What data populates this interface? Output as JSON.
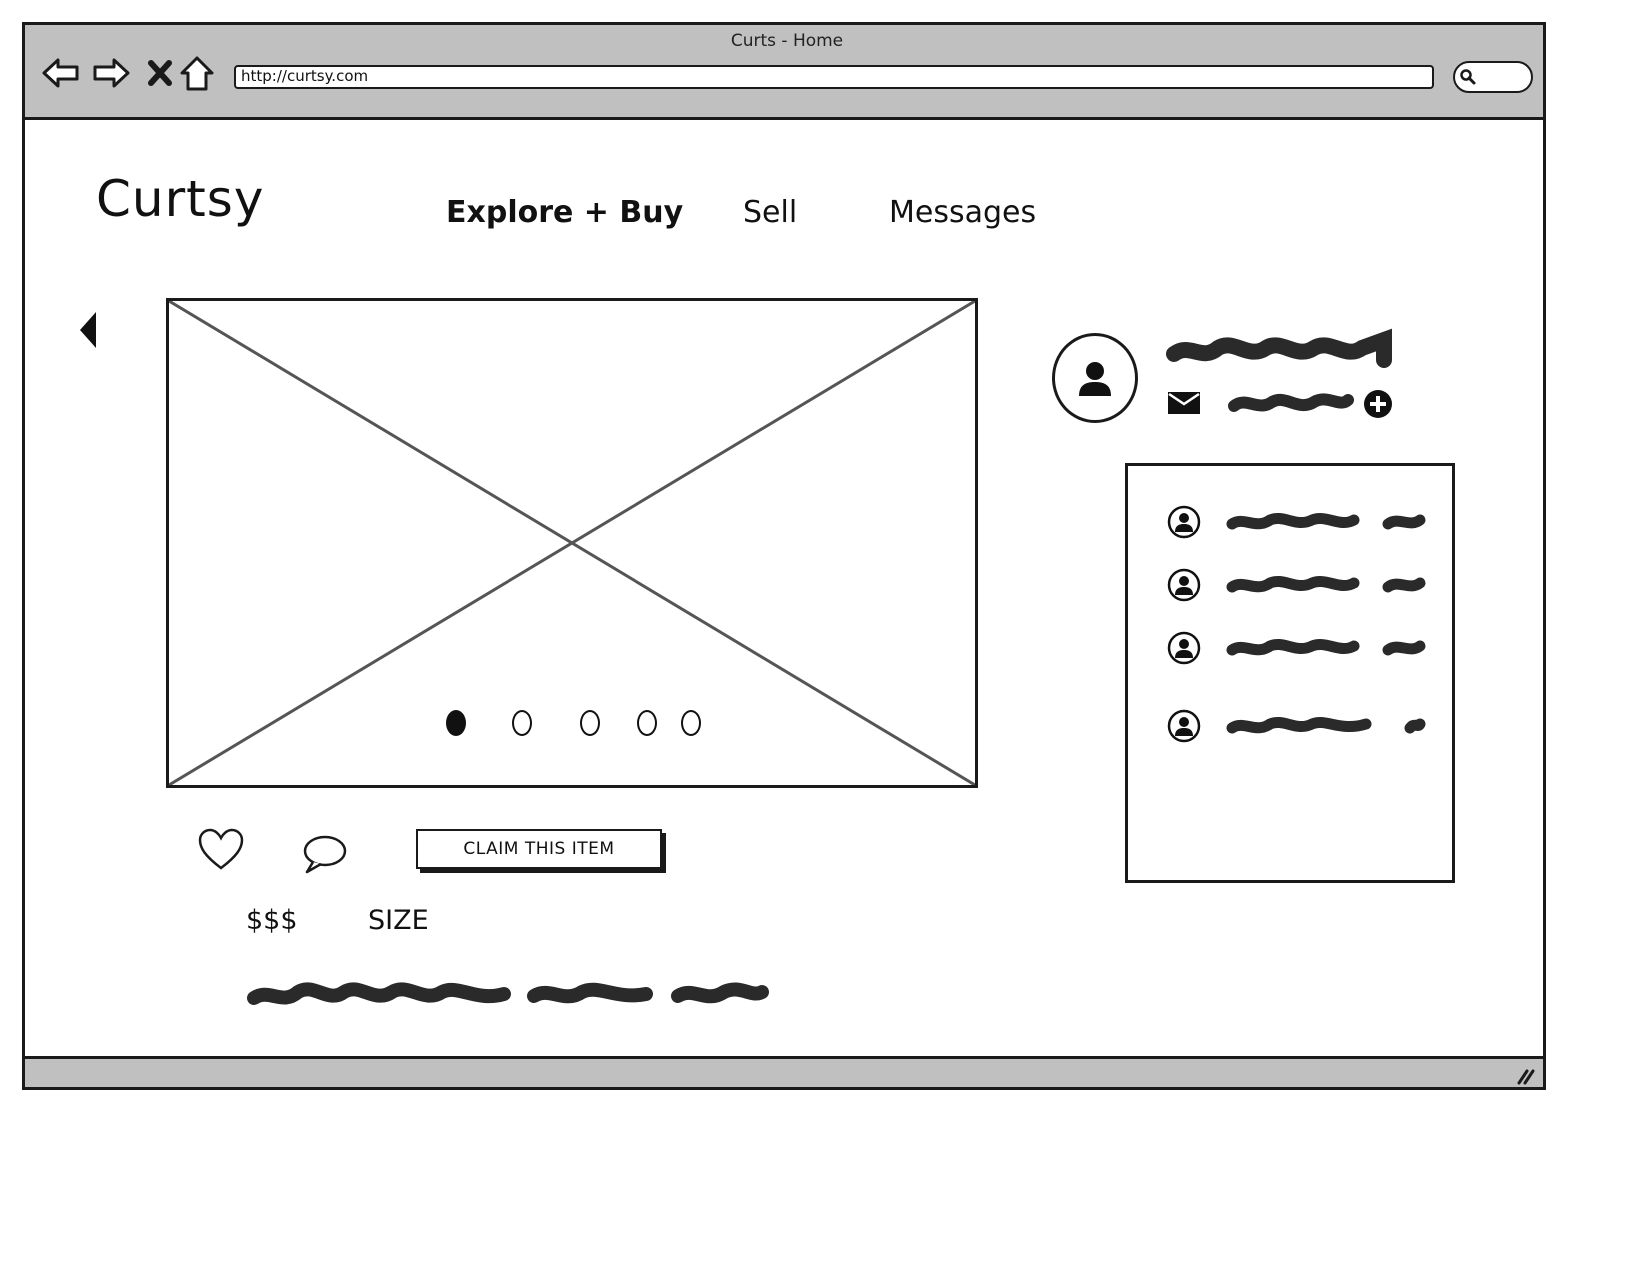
{
  "window": {
    "title": "Curts - Home",
    "url": "http://curtsy.com"
  },
  "toolbar": {
    "icons": [
      "back-arrow-icon",
      "forward-arrow-icon",
      "close-x-icon",
      "home-icon",
      "search-icon"
    ]
  },
  "header": {
    "logo": "Curtsy",
    "nav": [
      {
        "label": "Explore + Buy",
        "active": true
      },
      {
        "label": "Sell",
        "active": false
      },
      {
        "label": "Messages",
        "active": false
      }
    ]
  },
  "carousel": {
    "slide_count": 5,
    "active_index": 0
  },
  "actions": {
    "claim_label": "CLAIM THIS ITEM"
  },
  "listing": {
    "price": "$$$",
    "size": "SIZE"
  },
  "seller": {
    "follower_rows": 4
  },
  "colors": {
    "chrome": "#c0c0c0",
    "ink": "#1a1a1a",
    "background": "#ffffff"
  }
}
